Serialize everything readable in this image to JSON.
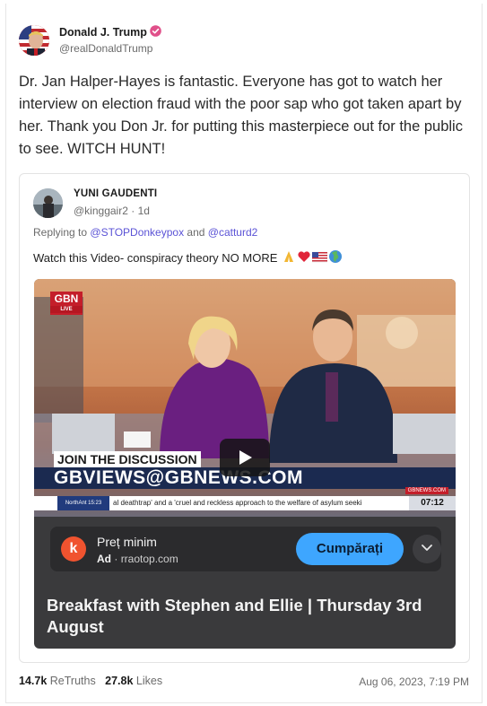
{
  "author": {
    "name": "Donald J. Trump",
    "handle": "@realDonaldTrump",
    "verified_color": "#e0508a"
  },
  "post": {
    "text": "Dr. Jan Halper-Hayes is fantastic. Everyone has got to watch her interview on election fraud with the poor sap who got taken apart by her. Thank you Don Jr. for putting this masterpiece out for the public to see. WITCH HUNT!"
  },
  "quote": {
    "name": "YUNI GAUDENTI",
    "handle": "@kinggair2",
    "separator": "·",
    "age": "1d",
    "replying_prefix": "Replying to",
    "reply_to_1": "@STOPDonkeypox",
    "reply_and": "and",
    "reply_to_2": "@catturd2",
    "text": "Watch this Video- conspiracy theory NO MORE",
    "emojis": [
      "praying-hands-icon",
      "red-heart-icon",
      "us-flag-icon",
      "globe-icon"
    ],
    "mention_color": "#5b53d6"
  },
  "video": {
    "channel_logo": "GBN",
    "channel_live": "LIVE",
    "banner_title": "JOIN THE DISCUSSION",
    "banner_url": "GBVIEWS@GBNEWS.COM",
    "banner_tag": "GBNEWS.COM",
    "ticker_label": "NorthAnt 15:23",
    "ticker_text": "al deathtrap' and a 'cruel and reckless approach to the welfare of asylum seeki",
    "ticker_time": "07:12",
    "ad": {
      "logo_letter": "k",
      "title": "Preț minim",
      "label": "Ad",
      "dot": "·",
      "domain": "rraotop.com",
      "cta": "Cumpărați"
    },
    "title": "Breakfast with Stephen and Ellie | Thursday 3rd August"
  },
  "stats": {
    "retruths_count": "14.7k",
    "retruths_label": "ReTruths",
    "likes_count": "27.8k",
    "likes_label": "Likes",
    "timestamp": "Aug 06, 2023, 7:19 PM"
  }
}
